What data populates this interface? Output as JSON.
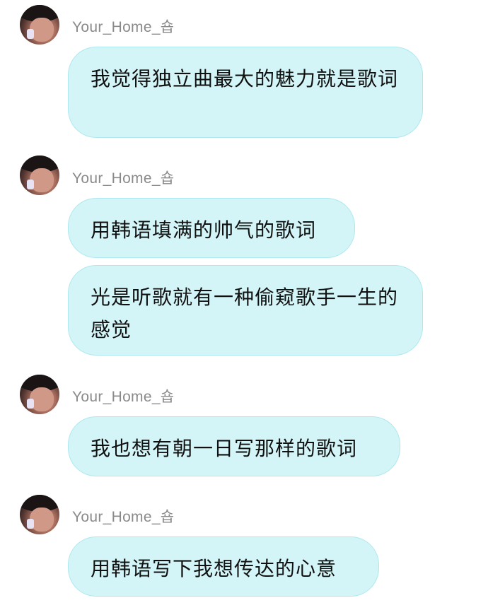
{
  "messages": [
    {
      "username": "Your_Home_숍",
      "bubbles": [
        "我觉得独立曲最大的魅力就是歌词"
      ]
    },
    {
      "username": "Your_Home_숍",
      "bubbles": [
        "用韩语填满的帅气的歌词",
        "光是听歌就有一种偷窥歌手一生的感觉"
      ]
    },
    {
      "username": "Your_Home_숍",
      "bubbles": [
        "我也想有朝一日写那样的歌词"
      ]
    },
    {
      "username": "Your_Home_숍",
      "bubbles": [
        "用韩语写下我想传达的心意"
      ]
    }
  ]
}
